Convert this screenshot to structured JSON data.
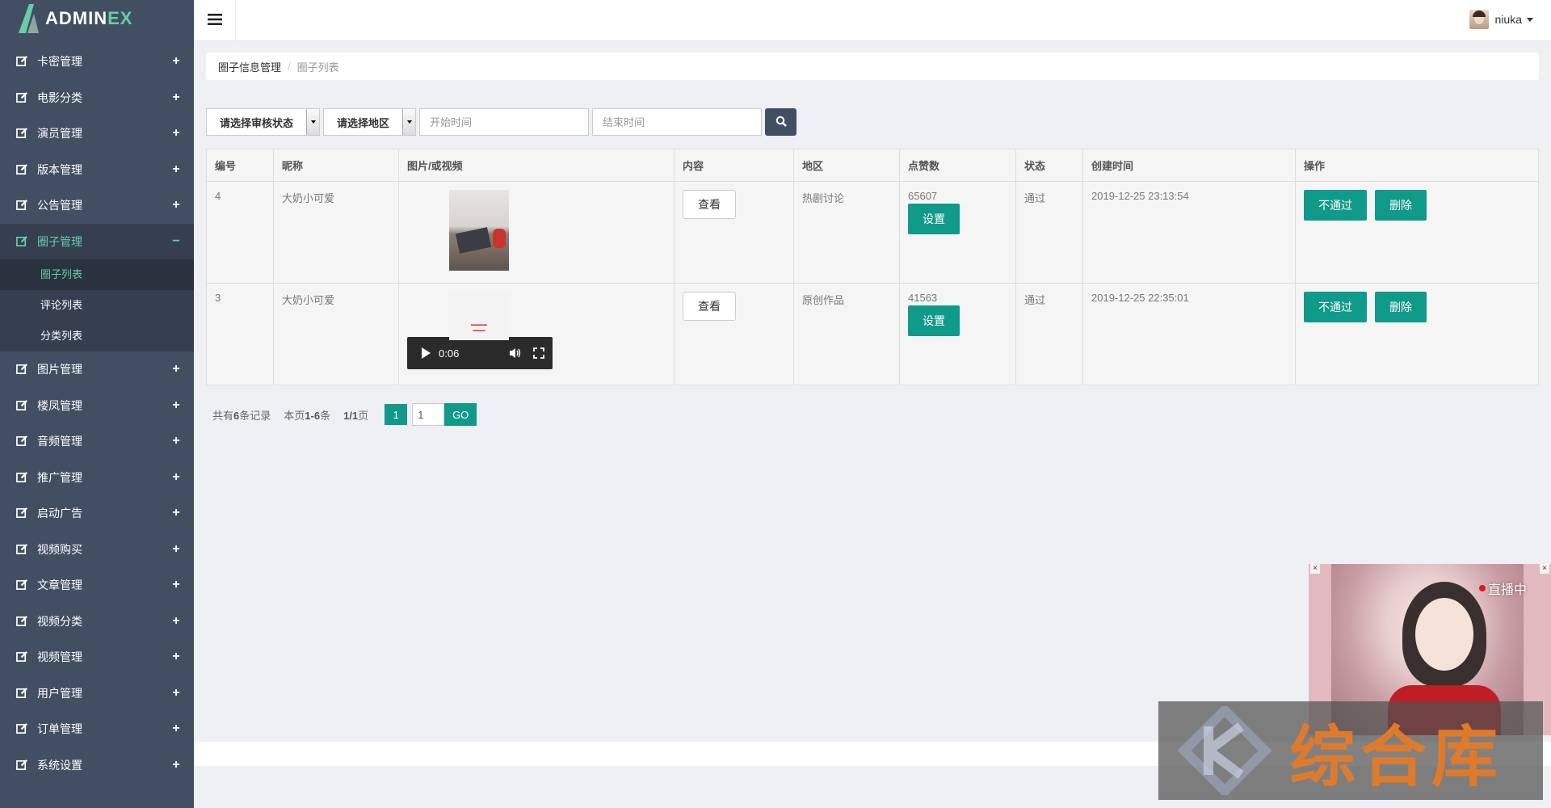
{
  "app": {
    "logo_text": "ADMIN",
    "logo_text_accent": "EX"
  },
  "user": {
    "name": "niuka"
  },
  "sidebar": {
    "items": [
      {
        "label": "卡密管理",
        "toggle": "+"
      },
      {
        "label": "电影分类",
        "toggle": "+"
      },
      {
        "label": "演员管理",
        "toggle": "+"
      },
      {
        "label": "版本管理",
        "toggle": "+"
      },
      {
        "label": "公告管理",
        "toggle": "+"
      },
      {
        "label": "圈子管理",
        "toggle": "−",
        "active": true
      },
      {
        "label": "图片管理",
        "toggle": "+"
      },
      {
        "label": "楼凤管理",
        "toggle": "+"
      },
      {
        "label": "音频管理",
        "toggle": "+"
      },
      {
        "label": "推广管理",
        "toggle": "+"
      },
      {
        "label": "启动广告",
        "toggle": "+"
      },
      {
        "label": "视频购买",
        "toggle": "+"
      },
      {
        "label": "文章管理",
        "toggle": "+"
      },
      {
        "label": "视频分类",
        "toggle": "+"
      },
      {
        "label": "视频管理",
        "toggle": "+"
      },
      {
        "label": "用户管理",
        "toggle": "+"
      },
      {
        "label": "订单管理",
        "toggle": "+"
      },
      {
        "label": "系统设置",
        "toggle": "+"
      }
    ],
    "submenu": [
      {
        "label": "圈子列表",
        "active": true
      },
      {
        "label": "评论列表"
      },
      {
        "label": "分类列表"
      }
    ]
  },
  "breadcrumb": {
    "parent": "圈子信息管理",
    "separator": "/",
    "current": "圈子列表"
  },
  "filters": {
    "status_select": "请选择审核状态",
    "region_select": "请选择地区",
    "start_placeholder": "开始时间",
    "end_placeholder": "结束时间"
  },
  "table": {
    "headers": [
      "编号",
      "昵称",
      "图片/或视频",
      "内容",
      "地区",
      "点赞数",
      "状态",
      "创建时间",
      "操作"
    ],
    "rows": [
      {
        "id": "4",
        "nickname": "大奶小可爱",
        "media": "image",
        "view_label": "查看",
        "region": "热剧讨论",
        "likes": "65607",
        "set_label": "设置",
        "status": "通过",
        "created": "2019-12-25 23:13:54",
        "reject_label": "不通过",
        "delete_label": "删除"
      },
      {
        "id": "3",
        "nickname": "大奶小可爱",
        "media": "video",
        "video_time": "0:06",
        "view_label": "查看",
        "region": "原创作品",
        "likes": "41563",
        "set_label": "设置",
        "status": "通过",
        "created": "2019-12-25 22:35:01",
        "reject_label": "不通过",
        "delete_label": "删除"
      }
    ]
  },
  "pager": {
    "total_prefix": "共有",
    "total_count": "6",
    "total_suffix": "条记录",
    "range_prefix": "本页",
    "range": "1-6",
    "range_suffix": "条",
    "pages": "1/1",
    "pages_suffix": "页",
    "current_page": "1",
    "jump_value": "1",
    "go_label": "GO"
  },
  "ad": {
    "badge": "直播中",
    "close": "×"
  },
  "watermark": {
    "text": "综合库"
  },
  "colors": {
    "sidebar": "#424f63",
    "accent": "#65cea7",
    "button": "#109a89",
    "search_button": "#424f63"
  }
}
